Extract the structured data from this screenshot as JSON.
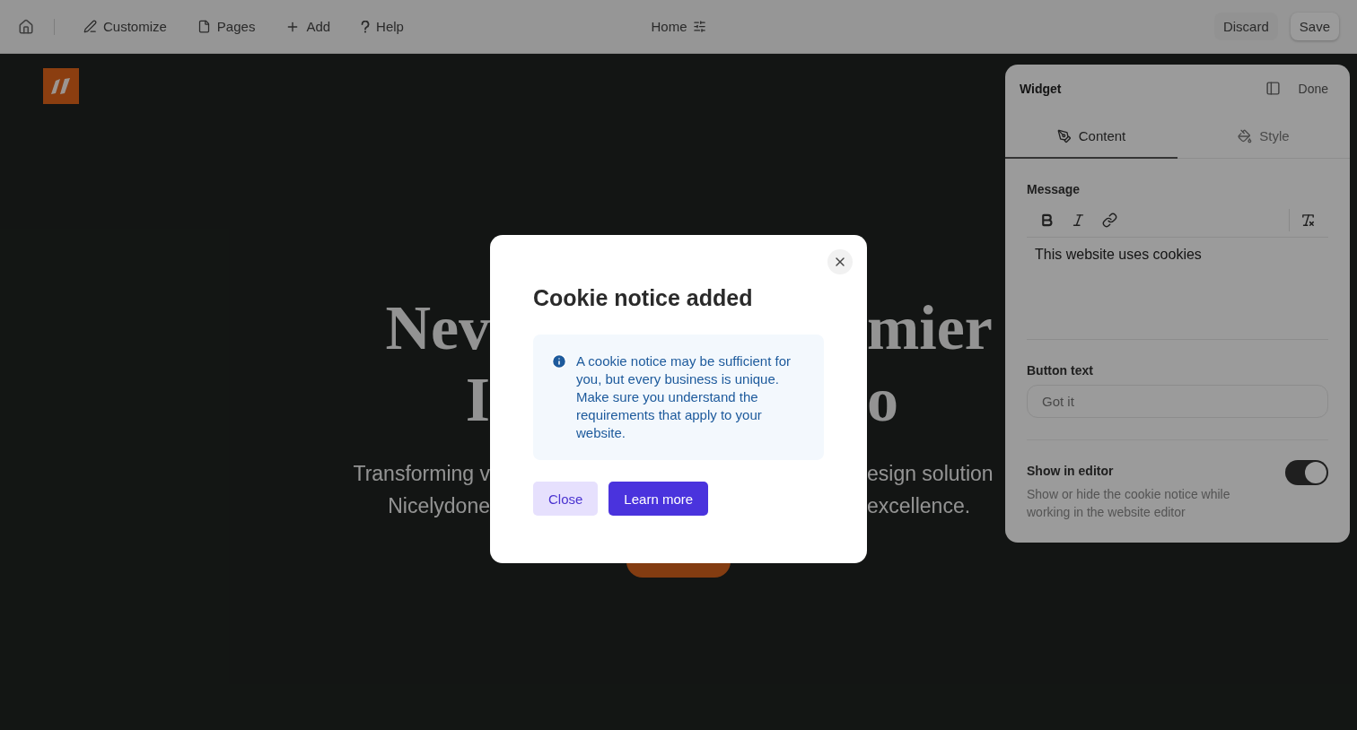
{
  "toolbar": {
    "items": [
      {
        "label": "Customize",
        "kind": "customize"
      },
      {
        "label": "Pages",
        "kind": "pages"
      },
      {
        "label": "Add",
        "kind": "add"
      },
      {
        "label": "Help",
        "kind": "help"
      }
    ],
    "page_title": "Home",
    "actions": [
      {
        "label": "Discard",
        "kind": "plain"
      },
      {
        "label": "Save",
        "kind": "raised"
      }
    ]
  },
  "site": {
    "headline": [
      {
        "left": "Nev",
        "right": "mier"
      },
      {
        "left": "I",
        "right": "o"
      }
    ],
    "subtitle": [
      {
        "left": "Transforming v",
        "right": "esign solution"
      },
      {
        "left": "Nicelydone",
        "right": "excellence."
      }
    ]
  },
  "panel": {
    "title": "Widget",
    "done": "Done",
    "tabs": [
      {
        "label": "Content",
        "kind": "content",
        "selected": true
      },
      {
        "label": "Style",
        "kind": "style",
        "selected": false
      }
    ],
    "message_label": "Message",
    "message": "This website uses cookies",
    "button_text_label": "Button text",
    "button_text": "Got it",
    "show_in_editor": {
      "label": "Show in editor",
      "description": "Show or hide the cookie notice while working in the website editor",
      "on": true
    }
  },
  "dialog": {
    "title": "Cookie notice added",
    "notice": "A cookie notice may be sufficient for you, but every business is unique. Make sure you understand the requirements that apply to your website.",
    "buttons": [
      {
        "label": "Close",
        "kind": "secondary"
      },
      {
        "label": "Learn more",
        "kind": "primary"
      }
    ]
  }
}
